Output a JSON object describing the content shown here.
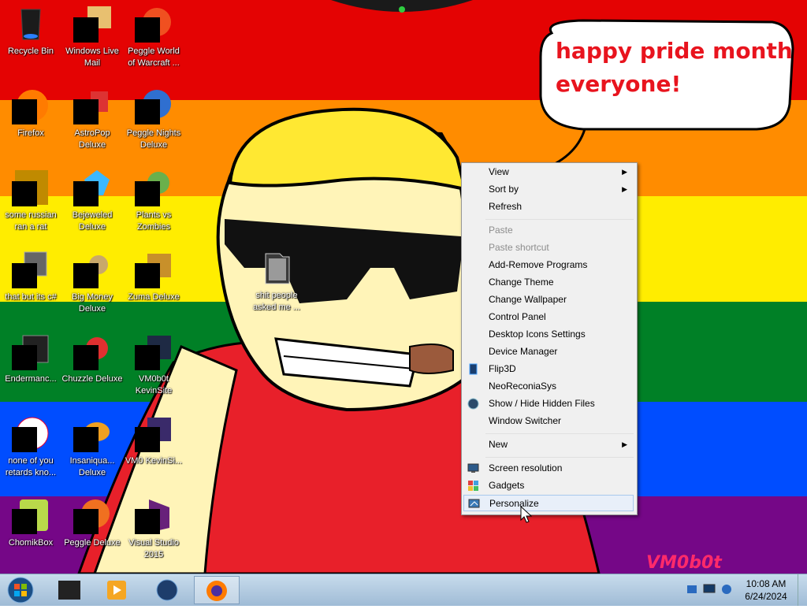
{
  "wallpaper": {
    "stripe_colors": [
      "#e40303",
      "#ff8c00",
      "#ffed00",
      "#008026",
      "#004dff",
      "#750787"
    ],
    "speech_line1": "happy pride month",
    "speech_line2": "everyone!",
    "watermark": "VM0b0t"
  },
  "desktop_icons": {
    "recycle_bin": "Recycle Bin",
    "windows_live_mail": "Windows Live Mail",
    "peggle_wow": "Peggle World of Warcraft ...",
    "firefox": "Firefox",
    "astropop": "AstroPop Deluxe",
    "peggle_nights": "Peggle Nights Deluxe",
    "russian_rat": "some russian ran a rat",
    "bejeweled": "Bejeweled Deluxe",
    "pvz": "Plants vs Zombies",
    "that_but": "that but its c#",
    "big_money": "Big Money Deluxe",
    "zuma": "Zuma Deluxe",
    "endermanc": "Endermanc...",
    "chuzzle": "Chuzzle Deluxe",
    "vm0b0t_kevin": "VM0b0t KevinSite",
    "none_of_you": "none of you retards kno...",
    "insaniquarium": "Insaniqua... Deluxe",
    "vm0_kevin": "VM0 KevinSi...",
    "chomikbox": "ChomikBox",
    "peggle_deluxe": "Peggle Deluxe",
    "visual_studio": "Visual Studio 2015",
    "folder": "shit people asked me ..."
  },
  "context_menu": {
    "view": "View",
    "sort_by": "Sort by",
    "refresh": "Refresh",
    "paste": "Paste",
    "paste_shortcut": "Paste shortcut",
    "add_remove": "Add-Remove Programs",
    "change_theme": "Change Theme",
    "change_wallpaper": "Change Wallpaper",
    "control_panel": "Control Panel",
    "desktop_icons_settings": "Desktop Icons Settings",
    "device_manager": "Device Manager",
    "flip3d": "Flip3D",
    "neoreconia": "NeoReconiaSys",
    "show_hide": "Show / Hide Hidden Files",
    "window_switcher": "Window Switcher",
    "new": "New",
    "screen_resolution": "Screen resolution",
    "gadgets": "Gadgets",
    "personalize": "Personalize",
    "submenu_arrow": "▶"
  },
  "taskbar": {
    "time": "10:08 AM",
    "date": "6/24/2024"
  }
}
